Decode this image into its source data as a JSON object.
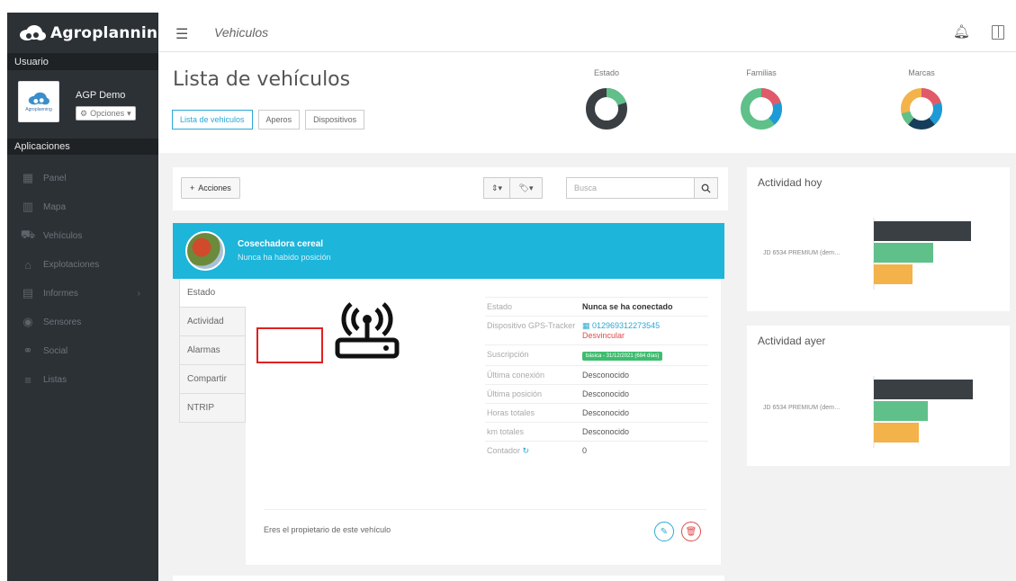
{
  "app": {
    "name": "Agroplanning"
  },
  "sidebar": {
    "user_section": "Usuario",
    "user_name": "AGP Demo",
    "avatar_brand": "Agroplanning",
    "options_label": "Opciones",
    "apps_section": "Aplicaciones",
    "items": [
      {
        "label": "Panel",
        "icon": "grid-icon"
      },
      {
        "label": "Mapa",
        "icon": "map-icon"
      },
      {
        "label": "Vehículos",
        "icon": "vehicle-icon"
      },
      {
        "label": "Explotaciones",
        "icon": "farm-icon"
      },
      {
        "label": "Informes",
        "icon": "report-icon"
      },
      {
        "label": "Sensores",
        "icon": "sensor-icon"
      },
      {
        "label": "Social",
        "icon": "social-icon"
      },
      {
        "label": "Listas",
        "icon": "list-icon"
      }
    ]
  },
  "topbar": {
    "breadcrumb": "Vehiculos"
  },
  "page": {
    "title": "Lista de vehículos",
    "tabs": [
      "Lista de vehiculos",
      "Aperos",
      "Dispositivos"
    ],
    "summaries": [
      {
        "label": "Estado",
        "colors": [
          "#3a3f44",
          "#5fc08a"
        ]
      },
      {
        "label": "Familias",
        "colors": [
          "#5fc08a",
          "#1e9bd7",
          "#e05a6a"
        ]
      },
      {
        "label": "Marcas",
        "colors": [
          "#e05a6a",
          "#1e9bd7",
          "#163e5c",
          "#5fc08a",
          "#f3b24a"
        ]
      }
    ]
  },
  "toolbar": {
    "actions_label": "Acciones",
    "search_placeholder": "Busca"
  },
  "vehicle": {
    "name": "Cosechadora cereal",
    "position_status": "Nunca ha habido posición",
    "tabs": [
      "Estado",
      "Actividad",
      "Alarmas",
      "Compartir",
      "NTRIP"
    ],
    "info": {
      "estado_label": "Estado",
      "estado_value": "Nunca se ha conectado",
      "device_label": "Dispositivo GPS-Tracker",
      "device_value": "012969312273545",
      "unlink_label": "Desvincular",
      "subscription_label": "Suscripción",
      "subscription_value": "básica - 31/12/2021 (684 días)",
      "last_conn_label": "Última conexión",
      "last_conn_value": "Desconocido",
      "last_pos_label": "Última posición",
      "last_pos_value": "Desconocido",
      "hours_label": "Horas totales",
      "hours_value": "Desconocido",
      "km_label": "km totales",
      "km_value": "Desconocido",
      "counter_label": "Contador",
      "counter_value": "0"
    },
    "owner_note": "Eres el propietario de este vehículo"
  },
  "activity_today": {
    "title": "Actividad hoy",
    "label": "JD 6534 PREMIUM (dem…",
    "bars": [
      0.9,
      0.55,
      0.36
    ]
  },
  "activity_yesterday": {
    "title": "Actividad ayer",
    "label": "JD 6534 PREMIUM (dem…",
    "bars": [
      0.92,
      0.5,
      0.42
    ]
  },
  "colors": {
    "accent": "#1db5d9",
    "sidebar": "#2c3136",
    "bar_dark": "#3a3f44",
    "bar_green": "#5fc08a",
    "bar_orange": "#f3b24a"
  }
}
